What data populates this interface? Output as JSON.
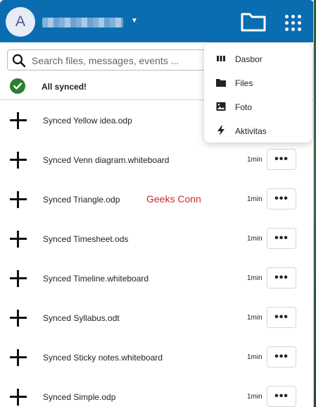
{
  "header": {
    "avatar_letter": "A",
    "accent_color": "#0a6db0",
    "folder_icon": "folder-icon",
    "apps_icon": "apps-grid-icon"
  },
  "search": {
    "placeholder": "Search files, messages, events ..."
  },
  "status": {
    "text": "All synced!",
    "color": "#2e7d32"
  },
  "files": [
    {
      "name": "Synced Yellow idea.odp",
      "time": ""
    },
    {
      "name": "Synced Venn diagram.whiteboard",
      "time": "1min"
    },
    {
      "name": "Synced Triangle.odp",
      "time": "1min"
    },
    {
      "name": "Synced Timesheet.ods",
      "time": "1min"
    },
    {
      "name": "Synced Timeline.whiteboard",
      "time": "1min"
    },
    {
      "name": "Synced Syllabus.odt",
      "time": "1min"
    },
    {
      "name": "Synced Sticky notes.whiteboard",
      "time": "1min"
    },
    {
      "name": "Synced Simple.odp",
      "time": "1min"
    }
  ],
  "more_label": "•••",
  "watermark": "Geeks Conn",
  "menu": {
    "items": [
      {
        "label": "Dasbor",
        "icon": "dashboard-icon"
      },
      {
        "label": "Files",
        "icon": "folder-icon"
      },
      {
        "label": "Foto",
        "icon": "image-icon"
      },
      {
        "label": "Aktivitas",
        "icon": "lightning-icon"
      }
    ]
  }
}
